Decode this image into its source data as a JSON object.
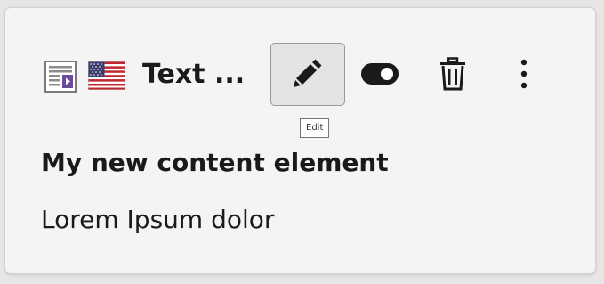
{
  "element": {
    "type_icon": "text-media-icon",
    "language_icon": "us-flag-icon",
    "title": "Text ...",
    "heading": "My new content element",
    "body": "Lorem Ipsum dolor"
  },
  "toolbar": {
    "edit_icon": "pencil-icon",
    "edit_tooltip": "Edit",
    "toggle_icon": "toggle-on-icon",
    "delete_icon": "trash-icon",
    "more_icon": "vertical-ellipsis-icon"
  },
  "colors": {
    "card_background": "#f4f4f4",
    "icon_color": "#1a1a1a",
    "active_button_background": "#e4e4e4"
  }
}
